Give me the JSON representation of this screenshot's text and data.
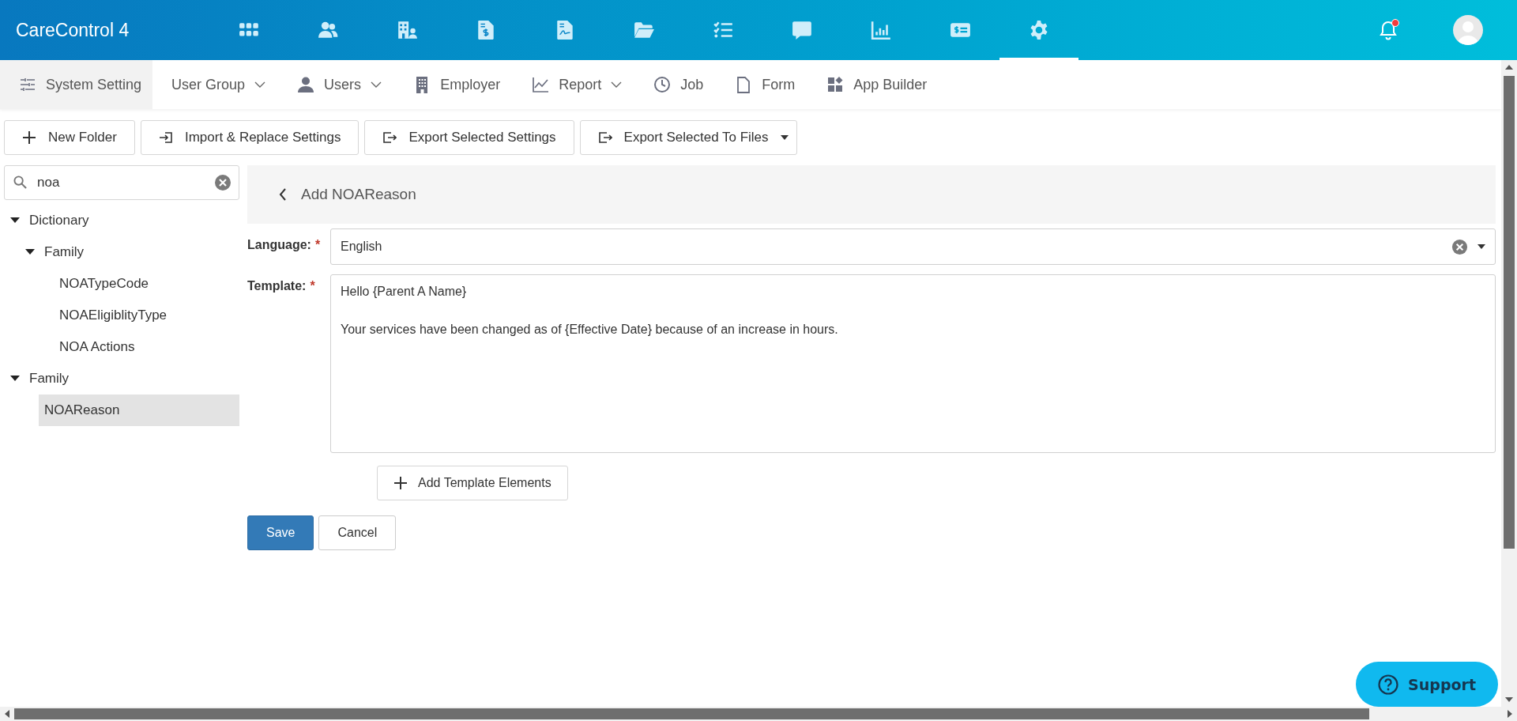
{
  "app_title": "CareControl 4",
  "top_icons": [
    {
      "kind": "grid",
      "selected": false
    },
    {
      "kind": "people",
      "selected": false
    },
    {
      "kind": "building",
      "selected": false
    },
    {
      "kind": "invoice",
      "selected": false
    },
    {
      "kind": "document",
      "selected": false
    },
    {
      "kind": "folder",
      "selected": false
    },
    {
      "kind": "checklist",
      "selected": false
    },
    {
      "kind": "chat",
      "selected": false
    },
    {
      "kind": "chart",
      "selected": false
    },
    {
      "kind": "card",
      "selected": false
    },
    {
      "kind": "gear",
      "selected": true
    }
  ],
  "notifications": {
    "unread": true
  },
  "nav_tabs": [
    {
      "label": "System Setting",
      "kind": "sliders",
      "dropdown": false,
      "selected": true
    },
    {
      "label": "User Group",
      "kind": "plain",
      "dropdown": true,
      "selected": false
    },
    {
      "label": "Users",
      "kind": "user",
      "dropdown": true,
      "selected": false
    },
    {
      "label": "Employer",
      "kind": "building",
      "dropdown": false,
      "selected": false
    },
    {
      "label": "Report",
      "kind": "linechart",
      "dropdown": true,
      "selected": false
    },
    {
      "label": "Job",
      "kind": "clock",
      "dropdown": false,
      "selected": false
    },
    {
      "label": "Form",
      "kind": "page",
      "dropdown": false,
      "selected": false
    },
    {
      "label": "App Builder",
      "kind": "blocks",
      "dropdown": false,
      "selected": false
    }
  ],
  "toolbar": [
    {
      "label": "New Folder",
      "kind": "plus",
      "dropdown": false
    },
    {
      "label": "Import & Replace Settings",
      "kind": "import",
      "dropdown": false
    },
    {
      "label": "Export Selected Settings",
      "kind": "export",
      "dropdown": false
    },
    {
      "label": "Export Selected To Files",
      "kind": "export",
      "dropdown": true
    }
  ],
  "search": {
    "value": "noa"
  },
  "tree": [
    {
      "label": "Dictionary",
      "expanded": true,
      "selected": false,
      "children": [
        {
          "label": "Family",
          "expanded": true,
          "selected": false,
          "children": [
            {
              "label": "NOATypeCode",
              "selected": false
            },
            {
              "label": "NOAEligiblityType",
              "selected": false
            },
            {
              "label": "NOA Actions",
              "selected": false
            }
          ]
        }
      ]
    },
    {
      "label": "Family",
      "expanded": true,
      "selected": false,
      "children": [
        {
          "label": "NOAReason",
          "selected": true
        }
      ]
    }
  ],
  "panel": {
    "title": "Add NOAReason",
    "language": {
      "label": "Language:",
      "required_mark": "*",
      "value": "English"
    },
    "template": {
      "label": "Template:",
      "required_mark": "*",
      "value": "Hello {Parent A Name}\n\nYour services have been changed as of {Effective Date} because of an increase in hours."
    },
    "add_button": "Add Template Elements",
    "actions": [
      {
        "label": "Save",
        "kind": "primary"
      },
      {
        "label": "Cancel",
        "kind": "secondary"
      }
    ]
  },
  "support": {
    "label": "Support"
  }
}
